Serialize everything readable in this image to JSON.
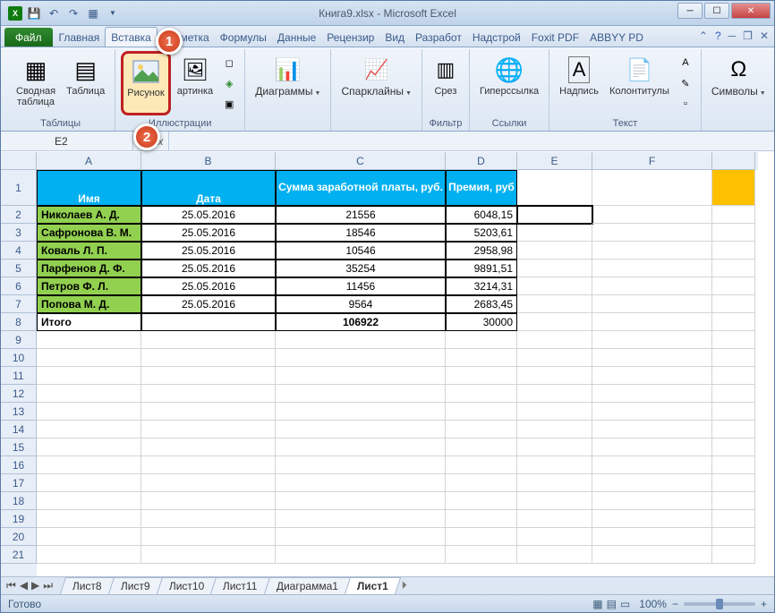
{
  "window": {
    "title": "Книга9.xlsx - Microsoft Excel"
  },
  "qat": {
    "save": "💾",
    "undo": "↶",
    "redo": "↷",
    "extra": "▦"
  },
  "tabs": {
    "file": "Файл",
    "home": "Главная",
    "insert": "Вставка",
    "layout": "Разметка",
    "formulas": "Формулы",
    "data": "Данные",
    "review": "Рецензир",
    "view": "Вид",
    "dev": "Разработ",
    "addins": "Надстрой",
    "foxit": "Foxit PDF",
    "abbyy": "ABBYY PD"
  },
  "ribbon": {
    "pivot": "Сводная\nтаблица",
    "table": "Таблица",
    "tables_grp": "Таблицы",
    "picture": "Рисунок",
    "clipart": "артинка",
    "illus_grp": "Иллюстрации",
    "charts": "Диаграммы",
    "spark": "Спарклайны",
    "slicer": "Срез",
    "filter_grp": "Фильтр",
    "hyperlink": "Гиперссылка",
    "links_grp": "Ссылки",
    "textbox": "Надпись",
    "hf": "Колонтитулы",
    "text_grp": "Текст",
    "symbols": "Символы"
  },
  "formula": {
    "namebox": "E2",
    "fx": "fx"
  },
  "cols": [
    "A",
    "B",
    "C",
    "D",
    "E",
    "F"
  ],
  "rows_visible": 21,
  "headers": {
    "name": "Имя",
    "date": "Дата",
    "salary": "Сумма заработной платы, руб.",
    "bonus": "Премия, руб"
  },
  "data": [
    {
      "name": "Николаев А. Д.",
      "date": "25.05.2016",
      "salary": "21556",
      "bonus": "6048,15"
    },
    {
      "name": "Сафронова В. М.",
      "date": "25.05.2016",
      "salary": "18546",
      "bonus": "5203,61"
    },
    {
      "name": "Коваль Л. П.",
      "date": "25.05.2016",
      "salary": "10546",
      "bonus": "2958,98"
    },
    {
      "name": "Парфенов Д. Ф.",
      "date": "25.05.2016",
      "salary": "35254",
      "bonus": "9891,51"
    },
    {
      "name": "Петров Ф. Л.",
      "date": "25.05.2016",
      "salary": "11456",
      "bonus": "3214,31"
    },
    {
      "name": "Попова М. Д.",
      "date": "25.05.2016",
      "salary": "9564",
      "bonus": "2683,45"
    }
  ],
  "total": {
    "label": "Итого",
    "salary": "106922",
    "bonus": "30000"
  },
  "sheets": [
    "Лист8",
    "Лист9",
    "Лист10",
    "Лист11",
    "Диаграмма1",
    "Лист1"
  ],
  "active_sheet": "Лист1",
  "status": "Готово",
  "zoom": "100%"
}
